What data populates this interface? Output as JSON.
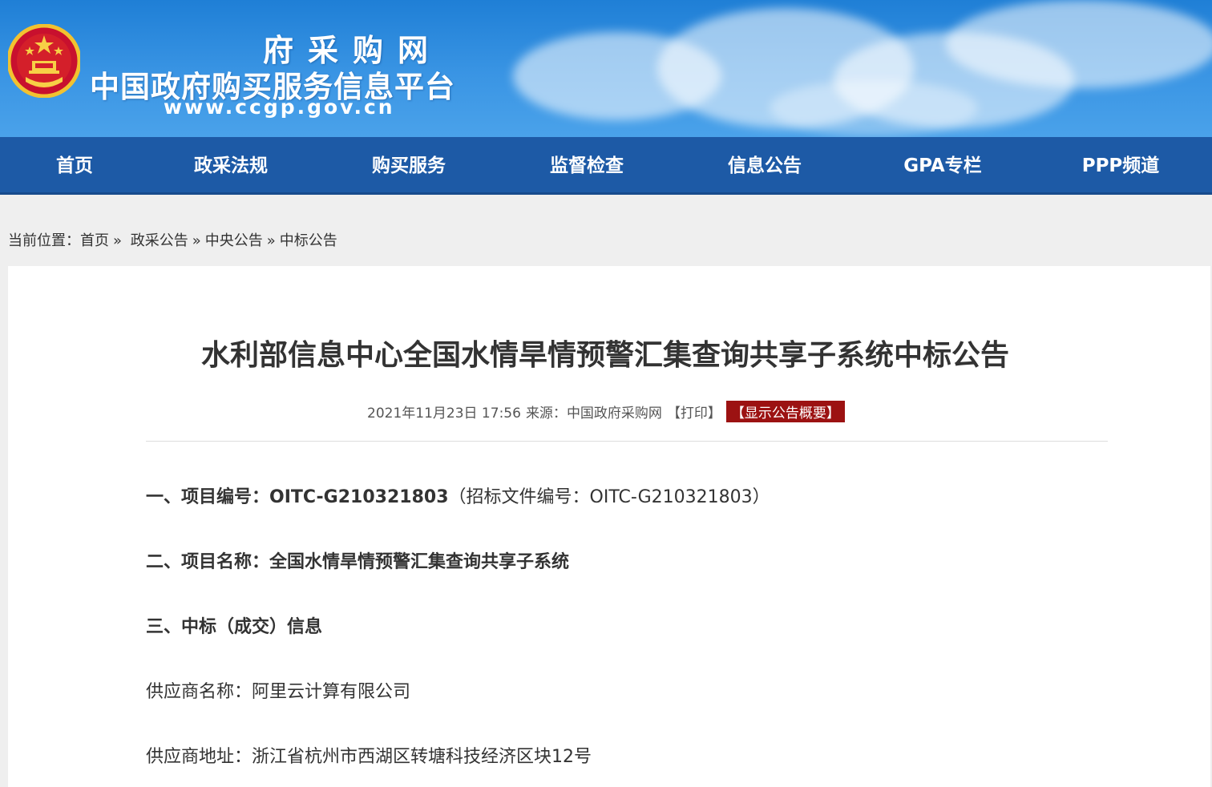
{
  "header": {
    "title_top": "府采购网",
    "title_main": "中国政府购买服务信息平台",
    "url": "www.ccgp.gov.cn"
  },
  "nav": {
    "items": [
      "首页",
      "政采法规",
      "购买服务",
      "监督检查",
      "信息公告",
      "GPA专栏",
      "PPP频道"
    ]
  },
  "breadcrumb": {
    "prefix": "当前位置：",
    "items": [
      "首页",
      "政采公告",
      "中央公告",
      "中标公告"
    ],
    "separator": "»"
  },
  "article": {
    "title": "水利部信息中心全国水情旱情预警汇集查询共享子系统中标公告",
    "datetime": "2021年11月23日 17:56",
    "source_label": "来源：",
    "source": "中国政府采购网",
    "print_label": "【打印】",
    "summary_label": "【显示公告概要】",
    "sections": [
      {
        "heading": "一、项目编号：OITC-G210321803",
        "text": "（招标文件编号：OITC-G210321803）"
      },
      {
        "heading": "二、项目名称：全国水情旱情预警汇集查询共享子系统",
        "text": ""
      },
      {
        "heading": "三、中标（成交）信息",
        "text": ""
      }
    ],
    "supplier_name": "供应商名称：阿里云计算有限公司",
    "supplier_address": "供应商地址：浙江省杭州市西湖区转塘科技经济区块12号"
  },
  "colors": {
    "banner": "#2f8ae0",
    "nav": "#1d5aa6",
    "summary_button": "#9c1212"
  }
}
